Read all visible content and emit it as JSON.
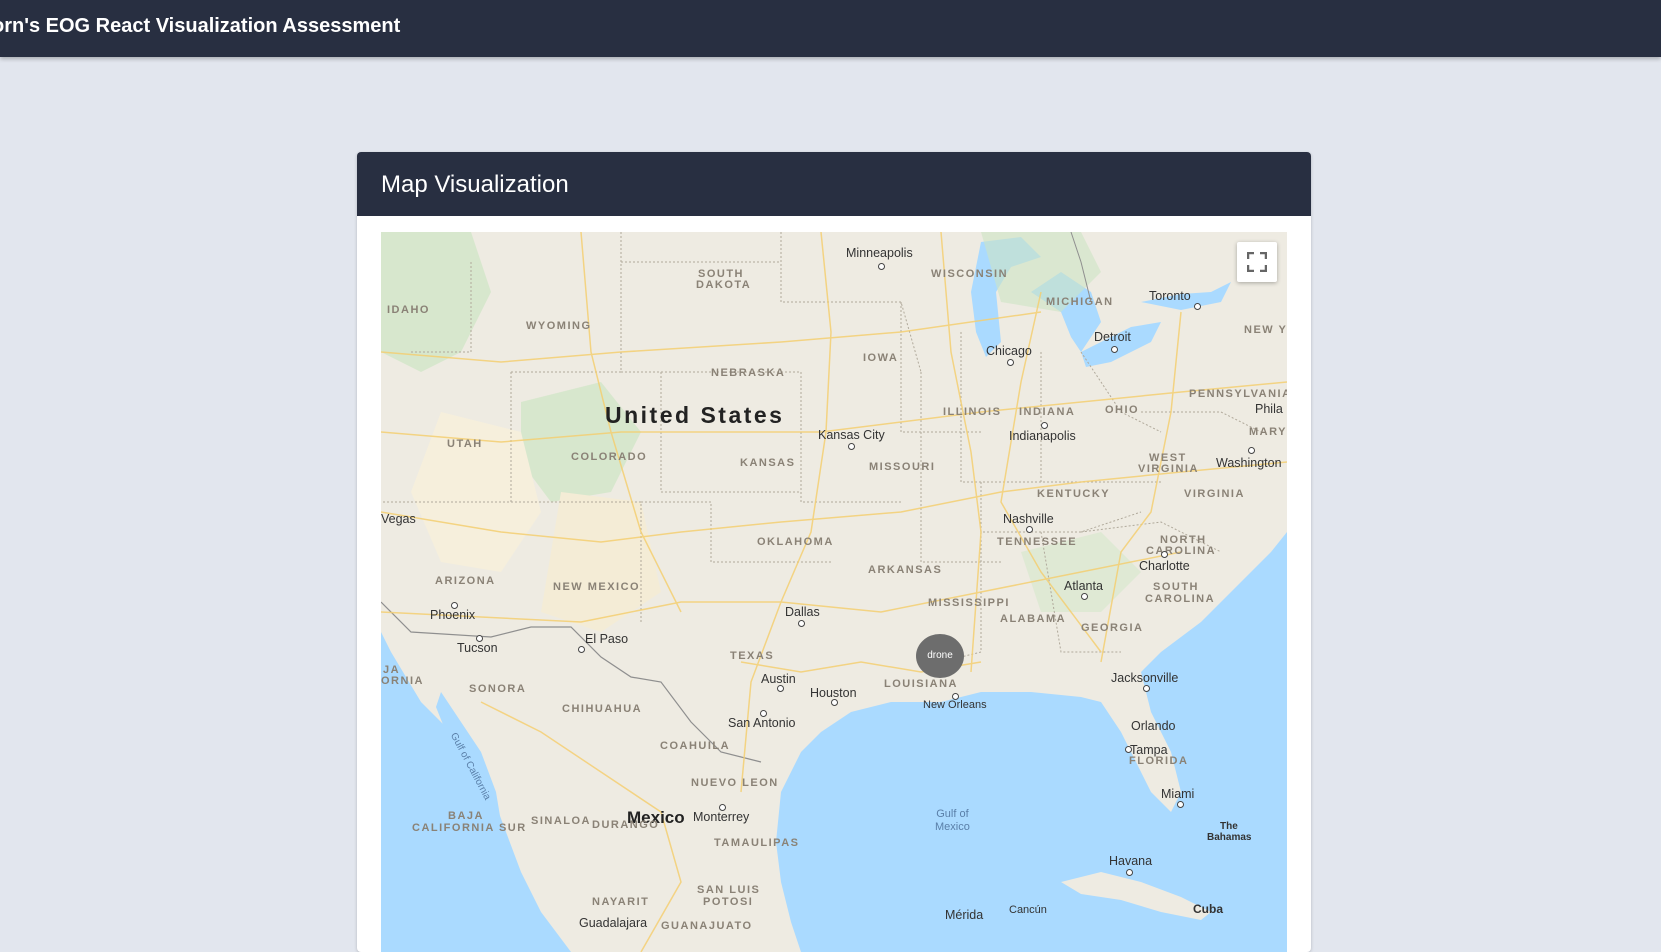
{
  "header": {
    "title": "orn's EOG React Visualization Assessment"
  },
  "card": {
    "title": "Map Visualization"
  },
  "map": {
    "marker_label": "drone",
    "fullscreen_icon": "fullscreen-icon",
    "countries": {
      "us": "United States",
      "mexico": "Mexico"
    },
    "states": {
      "idaho": "IDAHO",
      "south_dakota_1": "SOUTH",
      "south_dakota_2": "DAKOTA",
      "wyoming": "WYOMING",
      "nebraska": "NEBRASKA",
      "iowa": "IOWA",
      "wisconsin": "WISCONSIN",
      "michigan": "MICHIGAN",
      "new_york": "NEW YO",
      "utah": "UTAH",
      "colorado": "COLORADO",
      "kansas": "KANSAS",
      "missouri": "MISSOURI",
      "illinois": "ILLINOIS",
      "indiana": "INDIANA",
      "ohio": "OHIO",
      "pennsylvania": "PENNSYLVANIA",
      "maryland": "MARYLAND",
      "west_virginia_1": "WEST",
      "west_virginia_2": "VIRGINIA",
      "virginia": "VIRGINIA",
      "kentucky": "KENTUCKY",
      "tennessee": "TENNESSEE",
      "oklahoma": "OKLAHOMA",
      "arkansas": "ARKANSAS",
      "north_carolina_1": "NORTH",
      "north_carolina_2": "CAROLINA",
      "south_carolina_1": "SOUTH",
      "south_carolina_2": "CAROLINA",
      "arizona": "ARIZONA",
      "new_mexico": "NEW MEXICO",
      "mississippi": "MISSISSIPPI",
      "alabama": "ALABAMA",
      "georgia": "GEORGIA",
      "texas": "TEXAS",
      "louisiana": "LOUISIANA",
      "florida": "FLORIDA",
      "california_1": "JA",
      "california_2": "ORNIA",
      "sonora": "SONORA",
      "chihuahua": "CHIHUAHUA",
      "coahuila": "COAHUILA",
      "nuevo_leon": "NUEVO LEON",
      "baja_1": "BAJA",
      "baja_2": "CALIFORNIA SUR",
      "sinaloa": "SINALOA",
      "durango": "DURANGO",
      "tamaulipas": "TAMAULIPAS",
      "nayarit": "NAYARIT",
      "san_luis_1": "SAN LUIS",
      "san_luis_2": "POTOSI",
      "guanajuato": "GUANAJUATO"
    },
    "cities": {
      "minneapolis": "Minneapolis",
      "toronto": "Toronto",
      "detroit": "Detroit",
      "chicago": "Chicago",
      "phila": "Phila",
      "kansas_city": "Kansas City",
      "indianapolis": "Indianapolis",
      "washington": "Washington",
      "vegas": "Vegas",
      "nashville": "Nashville",
      "charlotte": "Charlotte",
      "atlanta": "Atlanta",
      "phoenix": "Phoenix",
      "dallas": "Dallas",
      "tucson": "Tucson",
      "el_paso": "El Paso",
      "jacksonville": "Jacksonville",
      "austin": "Austin",
      "houston": "Houston",
      "new_orleans": "New Orleans",
      "san_antonio": "San Antonio",
      "orlando": "Orlando",
      "tampa": "Tampa",
      "miami": "Miami",
      "monterrey": "Monterrey",
      "the_bahamas_1": "The",
      "the_bahamas_2": "Bahamas",
      "havana": "Havana",
      "merida": "Mérida",
      "cancun": "Cancún",
      "cuba": "Cuba",
      "guadalajara": "Guadalajara"
    },
    "water": {
      "gulf_of_mexico_1": "Gulf of",
      "gulf_of_mexico_2": "Mexico",
      "gulf_of_california": "Gulf of California"
    }
  }
}
